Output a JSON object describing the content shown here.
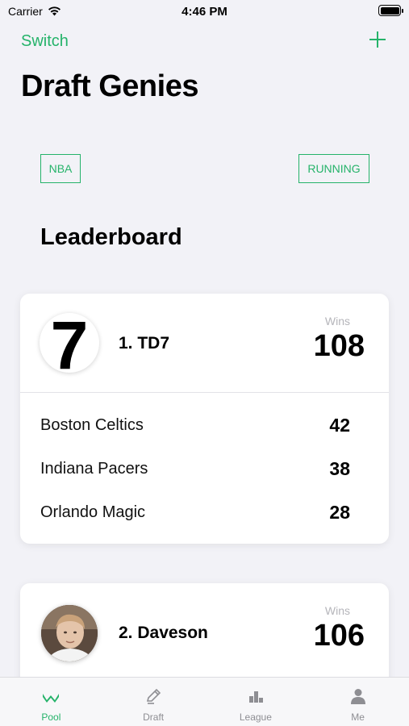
{
  "status_bar": {
    "carrier": "Carrier",
    "time": "4:46 PM"
  },
  "nav": {
    "switch_label": "Switch",
    "add_icon": "plus-icon",
    "accent_color": "#25b36a"
  },
  "page_title": "Draft Genies",
  "tags": {
    "sport": "NBA",
    "status": "RUNNING"
  },
  "leaderboard": {
    "title": "Leaderboard",
    "wins_label": "Wins",
    "entries": [
      {
        "rank_name": "1. TD7",
        "avatar_text": "7",
        "wins": "108",
        "teams": [
          {
            "name": "Boston Celtics",
            "wins": "42"
          },
          {
            "name": "Indiana Pacers",
            "wins": "38"
          },
          {
            "name": "Orlando Magic",
            "wins": "28"
          }
        ]
      },
      {
        "rank_name": "2. Daveson",
        "avatar_icon": "user-photo",
        "wins": "106"
      }
    ]
  },
  "tabs": [
    {
      "label": "Pool",
      "icon": "pool-icon",
      "active": true
    },
    {
      "label": "Draft",
      "icon": "pencil-icon",
      "active": false
    },
    {
      "label": "League",
      "icon": "podium-icon",
      "active": false
    },
    {
      "label": "Me",
      "icon": "person-icon",
      "active": false
    }
  ]
}
